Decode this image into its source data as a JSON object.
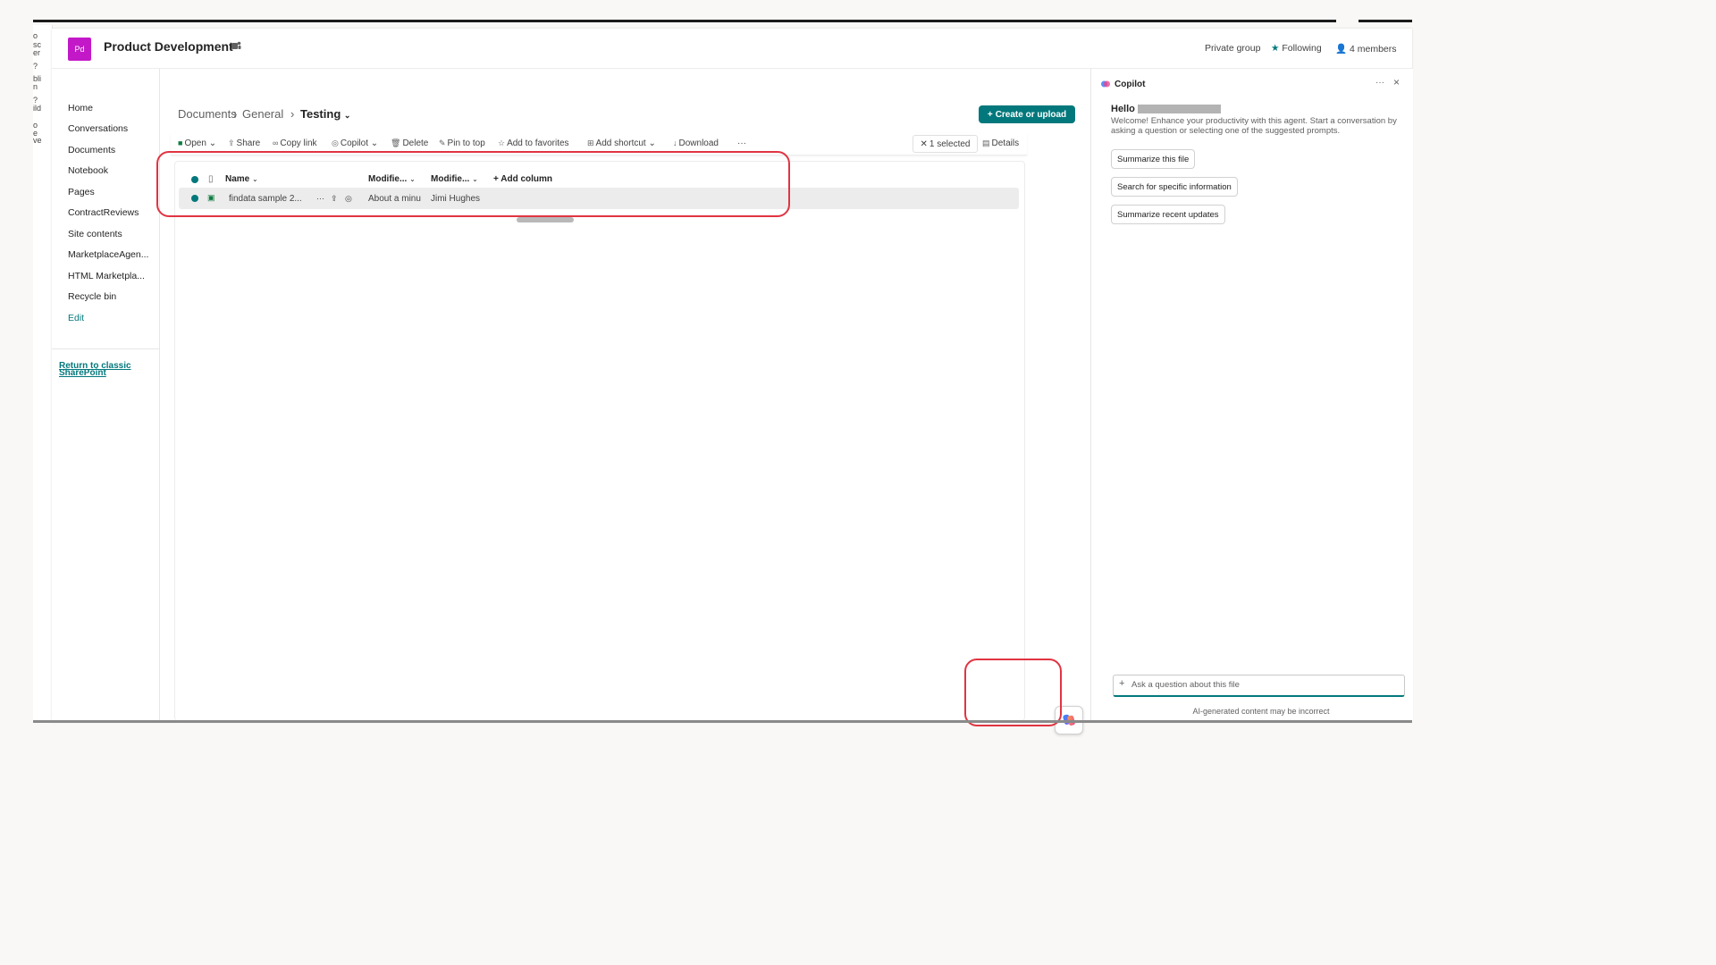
{
  "site": {
    "logo_text": "Pd",
    "title": "Product Development",
    "privacy": "Private group",
    "following": "Following",
    "members": "4 members"
  },
  "left_strip": [
    "o",
    "sc",
    "er",
    "?",
    "bli",
    "n",
    "?",
    "ild",
    "o",
    "e",
    "ve"
  ],
  "nav": {
    "items": [
      "Home",
      "Conversations",
      "Documents",
      "Notebook",
      "Pages",
      "ContractReviews",
      "Site contents",
      "MarketplaceAgen...",
      "HTML Marketpla...",
      "Recycle bin"
    ],
    "edit": "Edit",
    "classic": "Return to classic SharePoint"
  },
  "breadcrumb": {
    "items": [
      "Documents",
      "General"
    ],
    "current": "Testing"
  },
  "create_button": "Create or upload",
  "commands": {
    "open": "Open",
    "share": "Share",
    "copy_link": "Copy link",
    "copilot": "Copilot",
    "delete": "Delete",
    "pin": "Pin to top",
    "favorites": "Add to favorites",
    "shortcut": "Add shortcut",
    "download": "Download",
    "more": "···",
    "selected": "1 selected",
    "details": "Details"
  },
  "list": {
    "columns": [
      "Name",
      "Modifie...",
      "Modifie...",
      "Add column"
    ],
    "rows": [
      {
        "name": "findata sample 2...",
        "modified": "About a minu",
        "modified_by": "Jimi Hughes"
      }
    ]
  },
  "copilot_panel": {
    "title": "Copilot",
    "hello": "Hello",
    "welcome": "Welcome! Enhance your productivity with this agent. Start a conversation by asking a question or selecting one of the suggested prompts.",
    "prompts": [
      "Summarize this file",
      "Search for specific information",
      "Summarize recent updates"
    ],
    "input_placeholder": "Ask a question about this file",
    "disclaimer": "AI-generated content may be incorrect",
    "more": "···",
    "close": "×"
  },
  "colors": {
    "accent": "#03787c",
    "logo": "#c318c8",
    "highlight": "#e03442"
  }
}
